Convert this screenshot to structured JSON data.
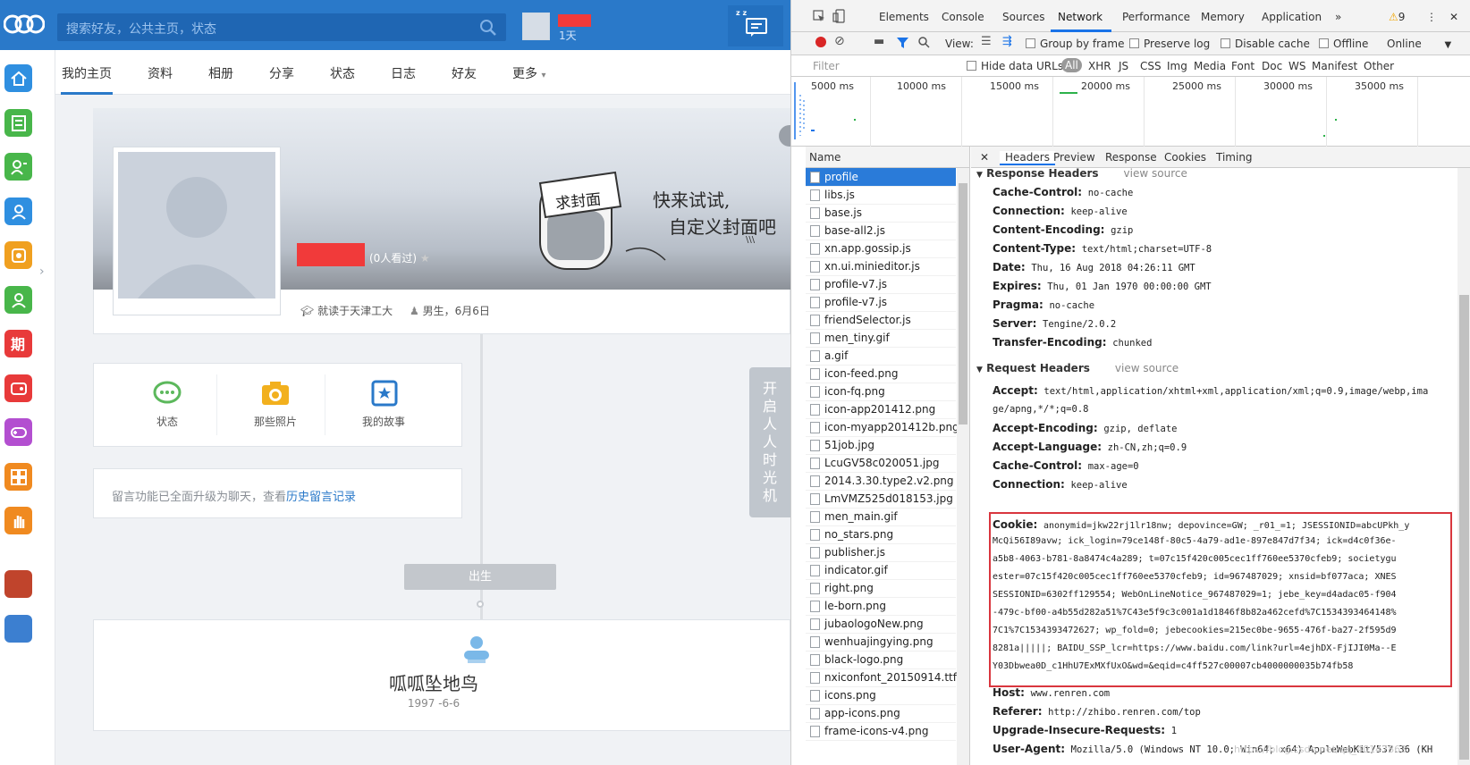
{
  "site": {
    "search_placeholder": "搜索好友，公共主页，状态",
    "user_days": "1天",
    "nav_tabs": [
      "我的主页",
      "资料",
      "相册",
      "分享",
      "状态",
      "日志",
      "好友",
      "更多"
    ],
    "profile": {
      "views": "(0人看过)",
      "school": "就读于天津工大",
      "gender_birthday": "男生，6月6日",
      "cover_sign": "求封面",
      "cover_text1": "快来试试,",
      "cover_text2": "自定义封面吧"
    },
    "shortcuts": [
      "状态",
      "那些照片",
      "我的故事"
    ],
    "notice_text": "留言功能已全面升级为聊天，查看",
    "notice_link": "历史留言记录",
    "timemachine": "开启人人时光机",
    "birth_badge": "出生",
    "birth_title": "呱呱坠地鸟",
    "birth_date": "1997 -6-6",
    "colors": {
      "brand": "#2a79c9",
      "red_mask": "#f13a3a"
    }
  },
  "devtools": {
    "tabs": [
      "Elements",
      "Console",
      "Sources",
      "Network",
      "Performance",
      "Memory",
      "Application"
    ],
    "warnings": "9",
    "toolbar": {
      "view_label": "View:",
      "group_by_frame": "Group by frame",
      "preserve_log": "Preserve log",
      "disable_cache": "Disable cache",
      "offline": "Offline",
      "throttle": "Online"
    },
    "filter": {
      "placeholder": "Filter",
      "hide_data_urls": "Hide data URLs",
      "types": [
        "All",
        "XHR",
        "JS",
        "CSS",
        "Img",
        "Media",
        "Font",
        "Doc",
        "WS",
        "Manifest",
        "Other"
      ]
    },
    "timeline_ticks": [
      "5000 ms",
      "10000 ms",
      "15000 ms",
      "20000 ms",
      "25000 ms",
      "30000 ms",
      "35000 ms"
    ],
    "name_header": "Name",
    "requests": [
      "profile",
      "libs.js",
      "base.js",
      "base-all2.js",
      "xn.app.gossip.js",
      "xn.ui.minieditor.js",
      "profile-v7.js",
      "profile-v7.js",
      "friendSelector.js",
      "men_tiny.gif",
      "a.gif",
      "icon-feed.png",
      "icon-fq.png",
      "icon-app201412.png",
      "icon-myapp201412b.png",
      "51job.jpg",
      "LcuGV58c020051.jpg",
      "2014.3.30.type2.v2.png",
      "LmVMZ525d018153.jpg",
      "men_main.gif",
      "no_stars.png",
      "publisher.js",
      "indicator.gif",
      "right.png",
      "le-born.png",
      "jubaologoNew.png",
      "wenhuajingying.png",
      "black-logo.png",
      "nxiconfont_20150914.ttf",
      "icons.png",
      "app-icons.png",
      "frame-icons-v4.png"
    ],
    "detail_tabs": [
      "Headers",
      "Preview",
      "Response",
      "Cookies",
      "Timing"
    ],
    "response_headers_title": "Response Headers",
    "request_headers_title": "Request Headers",
    "view_source": "view source",
    "response_headers": [
      {
        "k": "Cache-Control:",
        "v": "no-cache"
      },
      {
        "k": "Connection:",
        "v": "keep-alive"
      },
      {
        "k": "Content-Encoding:",
        "v": "gzip"
      },
      {
        "k": "Content-Type:",
        "v": "text/html;charset=UTF-8"
      },
      {
        "k": "Date:",
        "v": "Thu, 16 Aug 2018 04:26:11 GMT"
      },
      {
        "k": "Expires:",
        "v": "Thu, 01 Jan 1970 00:00:00 GMT"
      },
      {
        "k": "Pragma:",
        "v": "no-cache"
      },
      {
        "k": "Server:",
        "v": "Tengine/2.0.2"
      },
      {
        "k": "Transfer-Encoding:",
        "v": "chunked"
      }
    ],
    "accept_k": "Accept:",
    "accept_v1": "text/html,application/xhtml+xml,application/xml;q=0.9,image/webp,ima",
    "accept_v2": "ge/apng,*/*;q=0.8",
    "req_pre": [
      {
        "k": "Accept-Encoding:",
        "v": "gzip, deflate"
      },
      {
        "k": "Accept-Language:",
        "v": "zh-CN,zh;q=0.9"
      },
      {
        "k": "Cache-Control:",
        "v": "max-age=0"
      },
      {
        "k": "Connection:",
        "v": "keep-alive"
      }
    ],
    "cookie_k": "Cookie:",
    "cookie_lines": [
      "anonymid=jkw22rj1lr18nw; depovince=GW; _r01_=1; JSESSIONID=abcUPkh_y",
      "McQi56I89avw; ick_login=79ce148f-80c5-4a79-ad1e-897e847d7f34; ick=d4c0f36e-",
      "a5b8-4063-b781-8a8474c4a289; t=07c15f420c005cec1ff760ee5370cfeb9; societygu",
      "ester=07c15f420c005cec1ff760ee5370cfeb9; id=967487029; xnsid=bf077aca; XNES",
      "SESSIONID=6302ff129554; WebOnLineNotice_967487029=1; jebe_key=d4adac05-f904",
      "-479c-bf00-a4b55d282a51%7C43e5f9c3c001a1d1846f8b82a462cefd%7C1534393464148%",
      "7C1%7C1534393472627; wp_fold=0; jebecookies=215ec0be-9655-476f-ba27-2f595d9",
      "8281a|||||; BAIDU_SSP_lcr=https://www.baidu.com/link?url=4ejhDX-FjIJI0Ma--E",
      "Y03Dbwea0D_c1HhU7ExMXfUxO&wd=&eqid=c4ff527c00007cb4000000035b74fb58"
    ],
    "req_post": [
      {
        "k": "Host:",
        "v": "www.renren.com"
      },
      {
        "k": "Referer:",
        "v": "http://zhibo.renren.com/top"
      },
      {
        "k": "Upgrade-Insecure-Requests:",
        "v": "1"
      },
      {
        "k": "User-Agent:",
        "v": "Mozilla/5.0 (Windows NT 10.0; Win64; x64) AppleWebKit/537.36 (KH"
      }
    ],
    "watermark": "https://blog.csdn.net/qq_40147863"
  }
}
